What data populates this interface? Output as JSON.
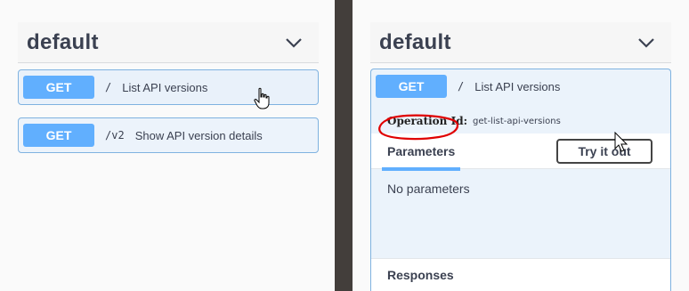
{
  "left": {
    "tag": {
      "title": "default"
    },
    "operations": [
      {
        "method": "GET",
        "path": "/",
        "description": "List API versions"
      },
      {
        "method": "GET",
        "path": "/v2",
        "description": "Show API version details"
      }
    ]
  },
  "right": {
    "tag": {
      "title": "default"
    },
    "operation": {
      "method": "GET",
      "path": "/",
      "description": "List API versions",
      "operation_id_label": "Operation Id:",
      "operation_id_value": "get-list-api-versions",
      "parameters_tab": "Parameters",
      "try_button": "Try it out",
      "no_parameters": "No parameters",
      "responses_title": "Responses"
    }
  },
  "colors": {
    "get_badge": "#61affe",
    "op_border": "#7fb2e0",
    "op_background": "#ecf3fb",
    "divider": "#433e3b",
    "annotation_circle": "#e00000"
  },
  "icons": [
    "chevron-down-icon",
    "hand-pointer-cursor-icon",
    "arrow-cursor-icon"
  ]
}
